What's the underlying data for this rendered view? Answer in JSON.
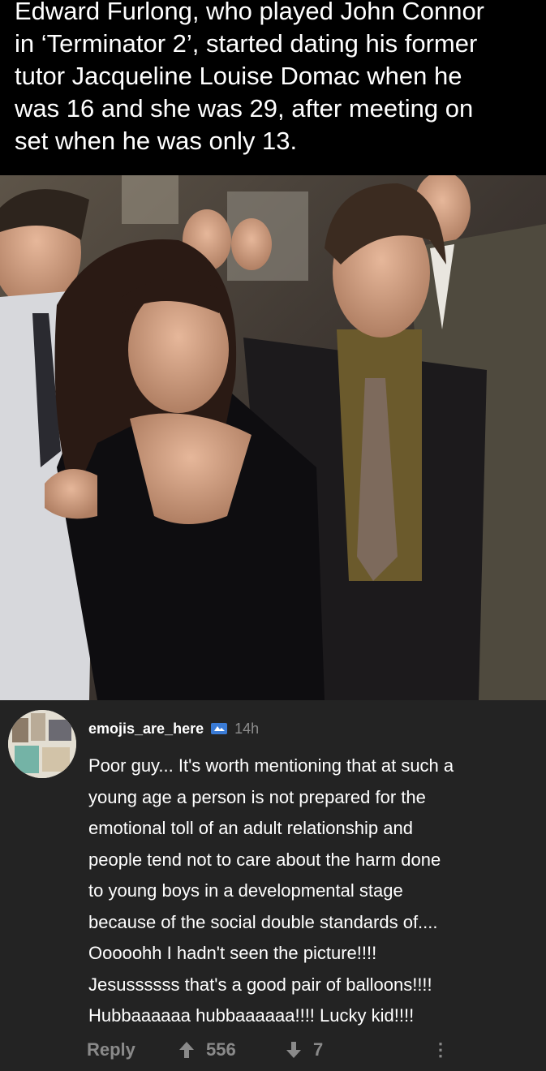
{
  "headline": {
    "lines": [
      "Edward Furlong, who played John Connor",
      "in ‘Terminator 2’, started dating his former",
      "tutor Jacqueline Louise Domac when he",
      "was 16 and she was 29, after meeting on",
      "set when he was only 13."
    ]
  },
  "photo": {
    "description_icon": "photo-of-couple-at-event"
  },
  "comment": {
    "username": "emojis_are_here",
    "badge_icon": "moderator-badge-icon",
    "time": "14h",
    "body_lines": [
      "Poor guy... It's worth mentioning that at such a",
      "young age a person is not prepared for the",
      "emotional toll of an adult relationship and",
      "people tend not to care about the harm done",
      "to young boys in a developmental stage",
      "because of the social double standards of....",
      "Ooooohh I hadn't seen the picture!!!!",
      "Jesussssss that's a good pair of balloons!!!!",
      "Hubbaaaaaa hubbaaaaaa!!!! Lucky kid!!!!"
    ],
    "actions": {
      "reply": "Reply",
      "upvotes": "556",
      "downvotes": "7",
      "more": "⋮"
    }
  },
  "colors": {
    "background": "#000000",
    "comment_bg": "#232323",
    "muted_text": "#8a8a8a"
  }
}
